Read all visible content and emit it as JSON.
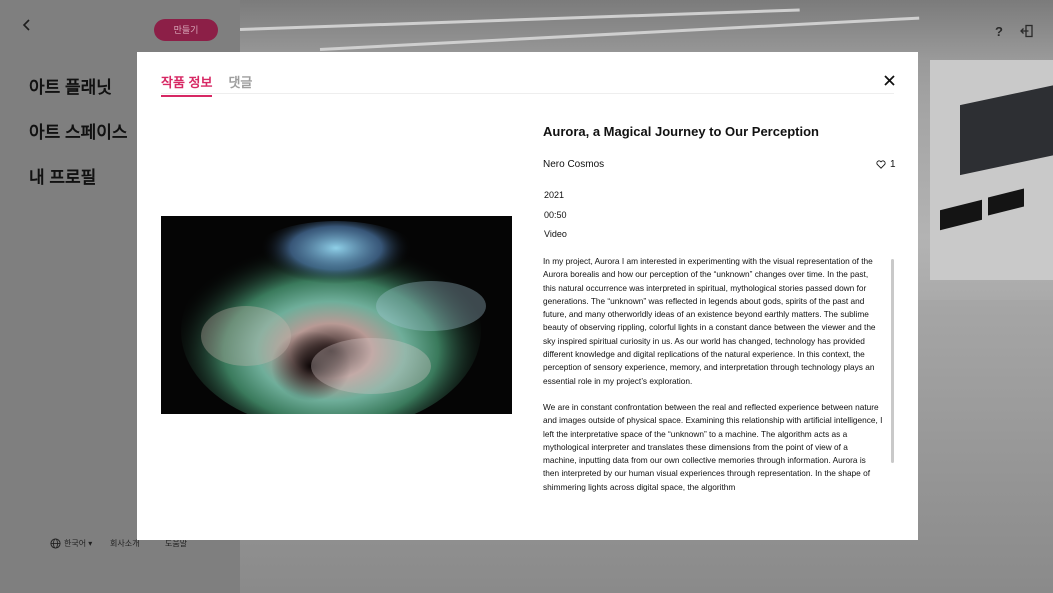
{
  "sidebar": {
    "back_label": "‹",
    "make_button": "만들기",
    "nav": [
      "아트 플래닛",
      "아트 스페이스",
      "내 프로필"
    ],
    "footer": {
      "language": "한국어 ▾",
      "company": "회사소개",
      "help": "도움말"
    }
  },
  "top_right": {
    "help_icon": "?",
    "exit_icon": "⎆"
  },
  "modal": {
    "tabs": [
      "작품 정보",
      "댓글"
    ],
    "active_tab": 0,
    "close_label": "✕",
    "title": "Aurora, a Magical Journey to Our Perception",
    "artist": "Nero Cosmos",
    "likes": "1",
    "year": "2021",
    "duration": "00:50",
    "medium": "Video",
    "description": [
      "In my project, Aurora I am interested in experimenting with the visual representation of the Aurora borealis and how our perception of the “unknown” changes over time. In the past, this natural occurrence was interpreted in spiritual, mythological stories passed down for generations. The “unknown” was reflected in legends about gods, spirits of the past and future, and many otherworldly ideas of an existence beyond earthly matters. The sublime beauty of observing rippling, colorful lights in a constant dance between the viewer and the sky inspired spiritual curiosity in us. As our world has changed, technology has provided different knowledge and digital replications of the natural experience. In this context, the perception of sensory experience, memory, and interpretation through technology plays an essential role in my project’s exploration.",
      "We are in constant confrontation between the real and reflected experience between nature and images outside of physical space. Examining this relationship with artificial intelligence, I left the interpretative space of the “unknown” to a machine. The algorithm acts as a mythological interpreter and translates these dimensions from the point of view of a machine, inputting data from our own collective memories through information. Aurora is then interpreted by our human visual experiences through representation. In the shape of shimmering lights across digital space, the algorithm"
    ]
  },
  "colors": {
    "accent": "#d72864",
    "make_button_bg": "#8c1f47"
  },
  "icons": {
    "back": "chevron-left-icon",
    "globe": "globe-icon",
    "heart": "heart-icon",
    "close": "close-icon",
    "help": "help-icon",
    "exit": "exit-icon"
  }
}
